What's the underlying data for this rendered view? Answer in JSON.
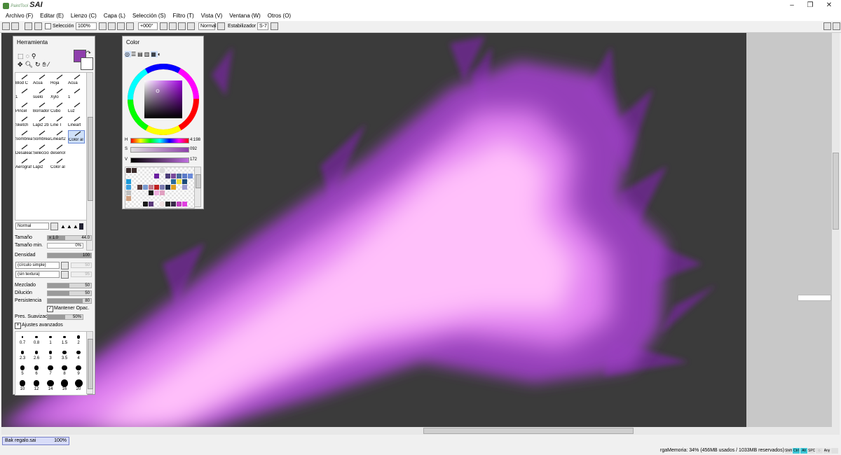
{
  "app": {
    "logo_small": "PaintTool",
    "logo_big": "SAI"
  },
  "window_controls": [
    "–",
    "❐",
    "✕"
  ],
  "menu": [
    "Archivo (F)",
    "Editar (E)",
    "Lienzo (C)",
    "Capa (L)",
    "Selección (S)",
    "Filtro (T)",
    "Vista (V)",
    "Ventana (W)",
    "Otros (O)"
  ],
  "toolbar": {
    "selection_label": "Selección",
    "zoom": "100%",
    "rotation": "+000°",
    "blend_mode": "Normal",
    "stabilizer_label": "Estabilizador",
    "stabilizer_value": "S-7"
  },
  "tool_panel": {
    "title": "Herramienta",
    "tools": [
      {
        "label": "Blod C"
      },
      {
        "label": "Acua"
      },
      {
        "label": "Hoja"
      },
      {
        "label": "Acua"
      },
      {
        "label": "1"
      },
      {
        "label": "suelo"
      },
      {
        "label": "Xylo"
      },
      {
        "label": "1"
      },
      {
        "label": "Pincel"
      },
      {
        "label": "Borrador"
      },
      {
        "label": "Cubo"
      },
      {
        "label": "Luz"
      },
      {
        "label": "Sketch"
      },
      {
        "label": "Lapiz 2b"
      },
      {
        "label": "Line T"
      },
      {
        "label": "Lineart"
      },
      {
        "label": "Sombrea"
      },
      {
        "label": "Sombrea"
      },
      {
        "label": "Lineart2"
      },
      {
        "label": "Color al"
      },
      {
        "label": "Desaleac"
      },
      {
        "label": "Seleccio"
      },
      {
        "label": "deseñol"
      },
      {
        "label": ""
      },
      {
        "label": "Aerograf"
      },
      {
        "label": "Lapiz"
      },
      {
        "label": "Color al"
      },
      {
        "label": ""
      }
    ],
    "blend_mode": "Normal",
    "size_label": "Tamaño",
    "size_multiplier": "x 1.0",
    "size_value": "44.0",
    "min_size_label": "Tamaño min.",
    "min_size_value": "0%",
    "density_label": "Densidad",
    "density_value": "100",
    "shape_value": "(círculo simple)",
    "shape_num": "50",
    "texture_value": "(sin textura)",
    "texture_num": "95",
    "blending_label": "Mezclado",
    "blending_value": "50",
    "dilution_label": "Dilución",
    "dilution_value": "50",
    "persistence_label": "Persistencia",
    "persistence_value": "80",
    "keep_opacity_label": "Mantener Opac.",
    "smoothing_label": "Pres. Suavizado",
    "smoothing_value": "50%",
    "advanced_label": "Ajustes avanzados",
    "brush_sizes": [
      [
        "0.7",
        "0.8",
        "1",
        "1.5",
        "2"
      ],
      [
        "2.3",
        "2.6",
        "3",
        "3.5",
        "4"
      ],
      [
        "5",
        "6",
        "7",
        "8",
        "9"
      ],
      [
        "10",
        "12",
        "14",
        "16",
        "20"
      ]
    ]
  },
  "color_panel": {
    "title": "Color",
    "h_label": "H",
    "h_value": "4:198",
    "s_label": "S",
    "s_value": "092",
    "v_label": "V",
    "v_value": "172",
    "main_color": "#8e3fac",
    "swatches": [
      "#3a2b2b",
      "#3a2b2b",
      "#ffffff",
      "#ffffff",
      "#ffffff",
      "#ffffff",
      "#dcdcdc",
      "#ffffff",
      "#ffffff",
      "#ffffff",
      "#ffffff",
      "#ffffff",
      "#ffffff",
      "#ffffff",
      "#ffffff",
      "#ffffff",
      "#ffffff",
      "#6a1fa0",
      "#ffffff",
      "#4a3c78",
      "#7a4b9c",
      "#4a6a9c",
      "#5a7ac8",
      "#6a8ad8",
      "#1a9ad8",
      "#ffffff",
      "#ffffff",
      "#ffffff",
      "#ffffff",
      "#ffffff",
      "#ffffff",
      "#ffffff",
      "#2a6a9c",
      "#f0e040",
      "#1a4a7a",
      "#ffffff",
      "#3aa0e0",
      "#ffffff",
      "#5a3a3a",
      "#7a9ad0",
      "#c07a8a",
      "#c02020",
      "#7a7ab0",
      "#1a2a4a",
      "#e0a020",
      "#ffffff",
      "#9a9ad0",
      "#ffffff",
      "#c0c0c0",
      "#ffffff",
      "#ffffff",
      "#ffffff",
      "#1a1a1a",
      "#f0b0e0",
      "#e0a0c0",
      "#ffffff",
      "#ffffff",
      "#ffffff",
      "#ffffff",
      "#ffffff",
      "#d0a080",
      "#ffffff",
      "#ffffff",
      "#ffffff",
      "#ffffff",
      "#ffffff",
      "#ffffff",
      "#ffffff",
      "#ffffff",
      "#ffffff",
      "#ffffff",
      "#ffffff",
      "#ffffff",
      "#ffffff",
      "#ffffff",
      "#1a1a1a",
      "#5a3a7a",
      "#ffffff",
      "#f0e0e0",
      "#1a1a1a",
      "#3a2a4a",
      "#c040c0",
      "#e040e0",
      "#ffffff"
    ]
  },
  "document": {
    "name": "Bak regalo.sai",
    "zoom": "100%"
  },
  "status": {
    "memory": "rgaMemoria: 34% (456MB usados / 1033MB reservados)",
    "icons": [
      "Shift",
      "Ctrl",
      "Alt",
      "SPC",
      "◌",
      "Any"
    ]
  }
}
